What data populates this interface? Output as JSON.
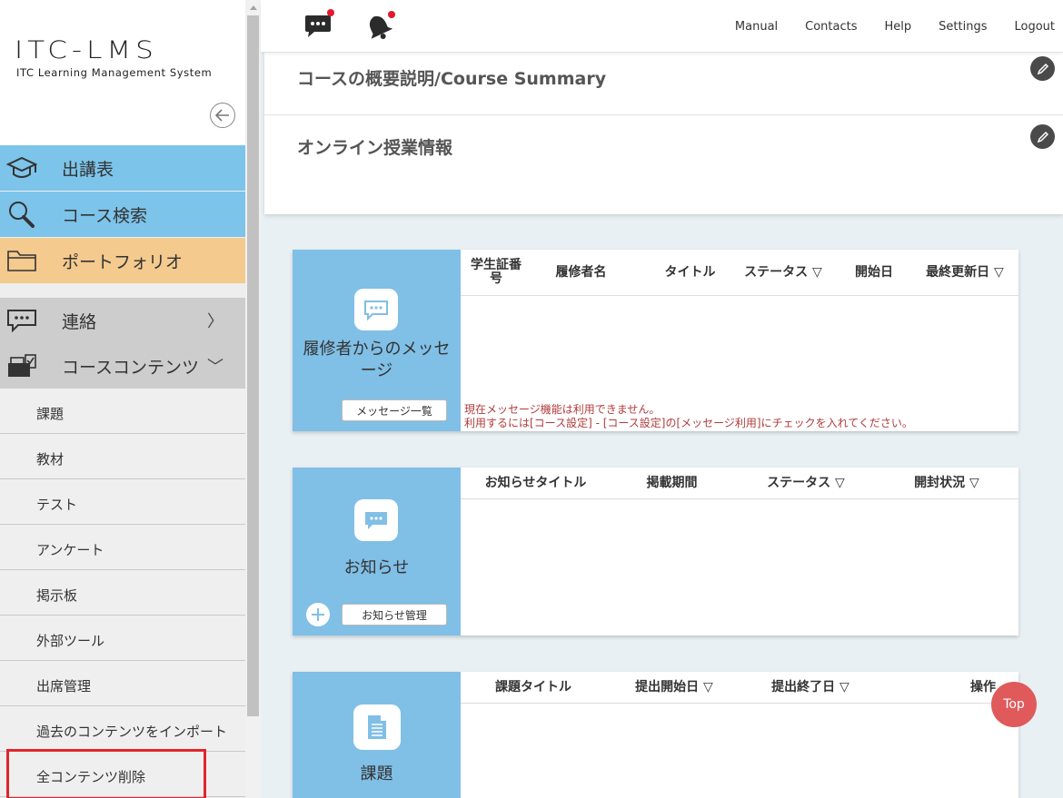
{
  "logo": {
    "title": "ITC-LMS",
    "subtitle": "ITC Learning Management System"
  },
  "sidebar": {
    "back_icon": "arrow-left-circle-icon",
    "main_items": [
      {
        "label": "出講表",
        "icon": "graduation-cap-icon",
        "color": "#7dc4ea"
      },
      {
        "label": "コース検索",
        "icon": "search-icon",
        "color": "#7dc4ea"
      },
      {
        "label": "ポートフォリオ",
        "icon": "folder-icon",
        "color": "#f4ca8e"
      },
      {
        "label": "連絡",
        "icon": "chat-bubble-icon",
        "arrow": "〉",
        "color": "#cdcdcd"
      },
      {
        "label": "コースコンテンツ",
        "icon": "course-contents-icon",
        "arrow": "﹀",
        "color": "#cdcdcd"
      }
    ],
    "sub_items": [
      "課題",
      "教材",
      "テスト",
      "アンケート",
      "掲示板",
      "外部ツール",
      "出席管理",
      "過去のコンテンツをインポート",
      "全コンテンツ削除"
    ],
    "highlight_color": "#e0262b"
  },
  "header": {
    "links": [
      "Manual",
      "Contacts",
      "Help",
      "Settings",
      "Logout"
    ],
    "icons": [
      "message-icon",
      "bell-icon"
    ]
  },
  "summary": {
    "course_summary_title": "コースの概要説明/Course Summary",
    "online_info_title": "オンライン授業情報"
  },
  "messages_panel": {
    "label": "履修者からのメッセージ",
    "button": "メッセージ一覧",
    "columns": [
      "学生証番号",
      "履修者名",
      "タイトル",
      "ステータス ▽",
      "開始日",
      "最終更新日 ▽"
    ],
    "notice_line1": "現在メッセージ機能は利用できません。",
    "notice_line2": "利用するには[コース設定] - [コース設定]の[メッセージ利用]にチェックを入れてください。"
  },
  "notices_panel": {
    "label": "お知らせ",
    "button": "お知らせ管理",
    "columns": [
      "お知らせタイトル",
      "掲載期間",
      "ステータス ▽",
      "開封状況 ▽"
    ]
  },
  "assignments_panel": {
    "label": "課題",
    "columns": [
      "課題タイトル",
      "提出開始日 ▽",
      "提出終了日 ▽",
      "操作"
    ]
  },
  "top_button": "Top",
  "colors": {
    "panel_blue": "#80bfe6",
    "notice_red": "#b23b3b",
    "top_button": "#e05a5b",
    "background": "#e9f0f4"
  }
}
